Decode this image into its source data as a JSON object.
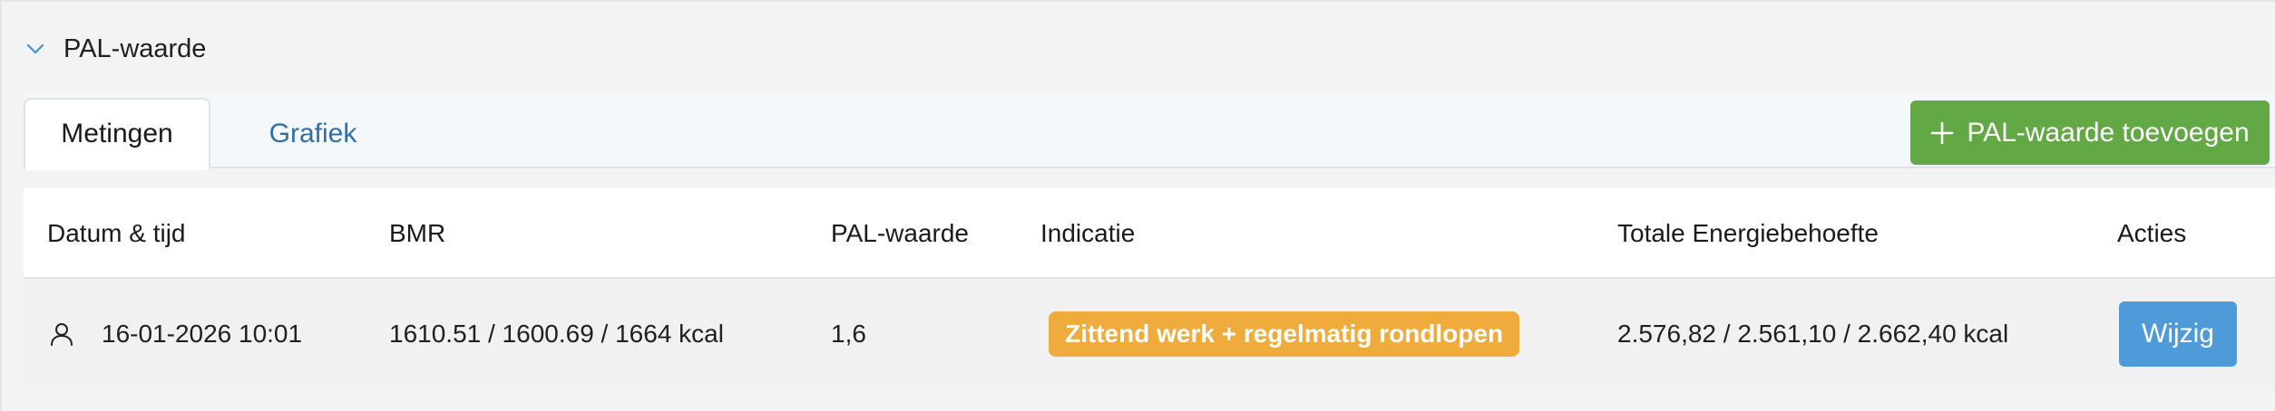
{
  "section": {
    "title": "PAL-waarde",
    "icon": "chevron-down-icon"
  },
  "tabs": [
    {
      "label": "Metingen",
      "active": true
    },
    {
      "label": "Grafiek",
      "active": false
    }
  ],
  "add_button": {
    "label": "PAL-waarde toevoegen",
    "icon": "plus-icon",
    "color": "#62a845"
  },
  "table": {
    "columns": [
      "Datum & tijd",
      "BMR",
      "PAL-waarde",
      "Indicatie",
      "Totale Energiebehoefte",
      "Acties"
    ],
    "rows": [
      {
        "icon": "user-icon",
        "datetime": "16-01-2026 10:01",
        "bmr": "1610.51 / 1600.69 / 1664 kcal",
        "pal": "1,6",
        "indicatie": "Zittend werk + regelmatig rondlopen",
        "energie": "2.576,82 / 2.561,10 / 2.662,40 kcal",
        "action_label": "Wijzig"
      }
    ]
  },
  "colors": {
    "badge": "#efab3b",
    "edit_button": "#4f9ad9",
    "tab_link": "#2f6fa6"
  }
}
